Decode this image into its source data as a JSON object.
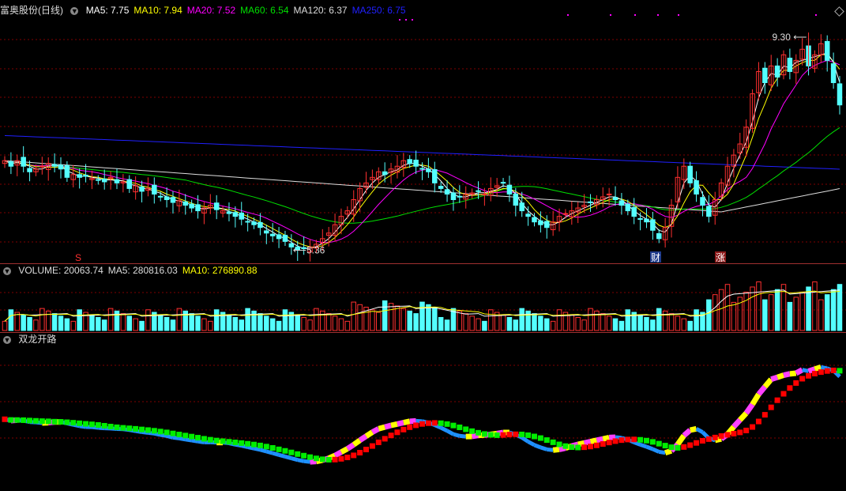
{
  "app": {
    "stock_title": "富奥股份(日线)"
  },
  "main_legend": {
    "items": [
      {
        "label": "MA5: 7.75",
        "color": "#ffffff"
      },
      {
        "label": "MA10: 7.94",
        "color": "#ffff00"
      },
      {
        "label": "MA20: 7.52",
        "color": "#ff00ff"
      },
      {
        "label": "MA60: 6.54",
        "color": "#00e000"
      },
      {
        "label": "MA120: 6.37",
        "color": "#dddddd"
      },
      {
        "label": "MA250: 6.75",
        "color": "#2020ff"
      }
    ]
  },
  "volume_legend": {
    "items": [
      {
        "label": "VOLUME: 20063.74",
        "color": "#dddddd"
      },
      {
        "label": "MA5: 280816.03",
        "color": "#dddddd"
      },
      {
        "label": "MA10: 276890.88",
        "color": "#ffff00"
      }
    ]
  },
  "indicator_legend": {
    "name": "双龙开路"
  },
  "annotations": {
    "high_label": "9.30",
    "low_label": "5.36",
    "marker_s": "S",
    "marker_cai": "财",
    "marker_zhang": "涨"
  },
  "colors": {
    "up": "#ff3030",
    "down": "#54ffff",
    "grid": "#800000",
    "ma5": "#ffffff",
    "ma10": "#ffff00",
    "ma20": "#ff00ff",
    "ma60": "#00e000",
    "ma120": "#dddddd",
    "ma250": "#2020ff",
    "dragon_red": "#ff0000",
    "dragon_green": "#00ee00",
    "dragon_blue": "#1e90ff",
    "dragon_hl_a": "#ffff00",
    "dragon_hl_b": "#ff40ff"
  },
  "chart_data": [
    {
      "type": "candlestick",
      "title": "富奥股份(日线)",
      "price_range": [
        5.2,
        9.6
      ],
      "high": 9.3,
      "low": 5.36,
      "close_values": [
        7.0,
        6.9,
        7.0,
        6.9,
        6.8,
        6.85,
        6.9,
        6.95,
        6.9,
        6.85,
        6.7,
        6.75,
        6.7,
        6.72,
        6.68,
        6.65,
        6.62,
        6.7,
        6.6,
        6.62,
        6.5,
        6.55,
        6.45,
        6.5,
        6.4,
        6.35,
        6.3,
        6.25,
        6.28,
        6.2,
        6.15,
        6.1,
        6.15,
        6.2,
        6.12,
        6.1,
        6.05,
        6.0,
        5.95,
        5.9,
        5.85,
        5.8,
        5.7,
        5.65,
        5.6,
        5.55,
        5.45,
        5.4,
        5.42,
        5.45,
        5.5,
        5.6,
        5.7,
        5.85,
        6.0,
        6.1,
        6.3,
        6.5,
        6.6,
        6.7,
        6.8,
        6.75,
        6.85,
        6.9,
        7.0,
        6.95,
        6.9,
        6.85,
        6.8,
        6.6,
        6.5,
        6.4,
        6.3,
        6.35,
        6.4,
        6.42,
        6.45,
        6.4,
        6.5,
        6.55,
        6.6,
        6.4,
        6.2,
        6.1,
        6.0,
        5.9,
        5.85,
        5.8,
        5.9,
        6.0,
        6.05,
        6.1,
        6.15,
        6.2,
        6.25,
        6.3,
        6.35,
        6.4,
        6.3,
        6.2,
        6.1,
        6.0,
        5.95,
        5.9,
        5.75,
        5.6,
        5.8,
        6.2,
        6.7,
        6.9,
        6.6,
        6.4,
        6.2,
        6.0,
        6.3,
        6.6,
        6.9,
        7.1,
        7.3,
        7.6,
        8.2,
        8.6,
        8.4,
        8.7,
        8.5,
        8.9,
        8.6,
        8.8,
        9.0,
        8.7,
        8.9,
        9.1,
        8.8,
        8.4,
        8.0
      ]
    },
    {
      "type": "bar",
      "title": "VOLUME",
      "volume": 20063.74,
      "ma5": 280816.03,
      "ma10": 276890.88
    },
    {
      "type": "line",
      "title": "双龙开路"
    }
  ]
}
